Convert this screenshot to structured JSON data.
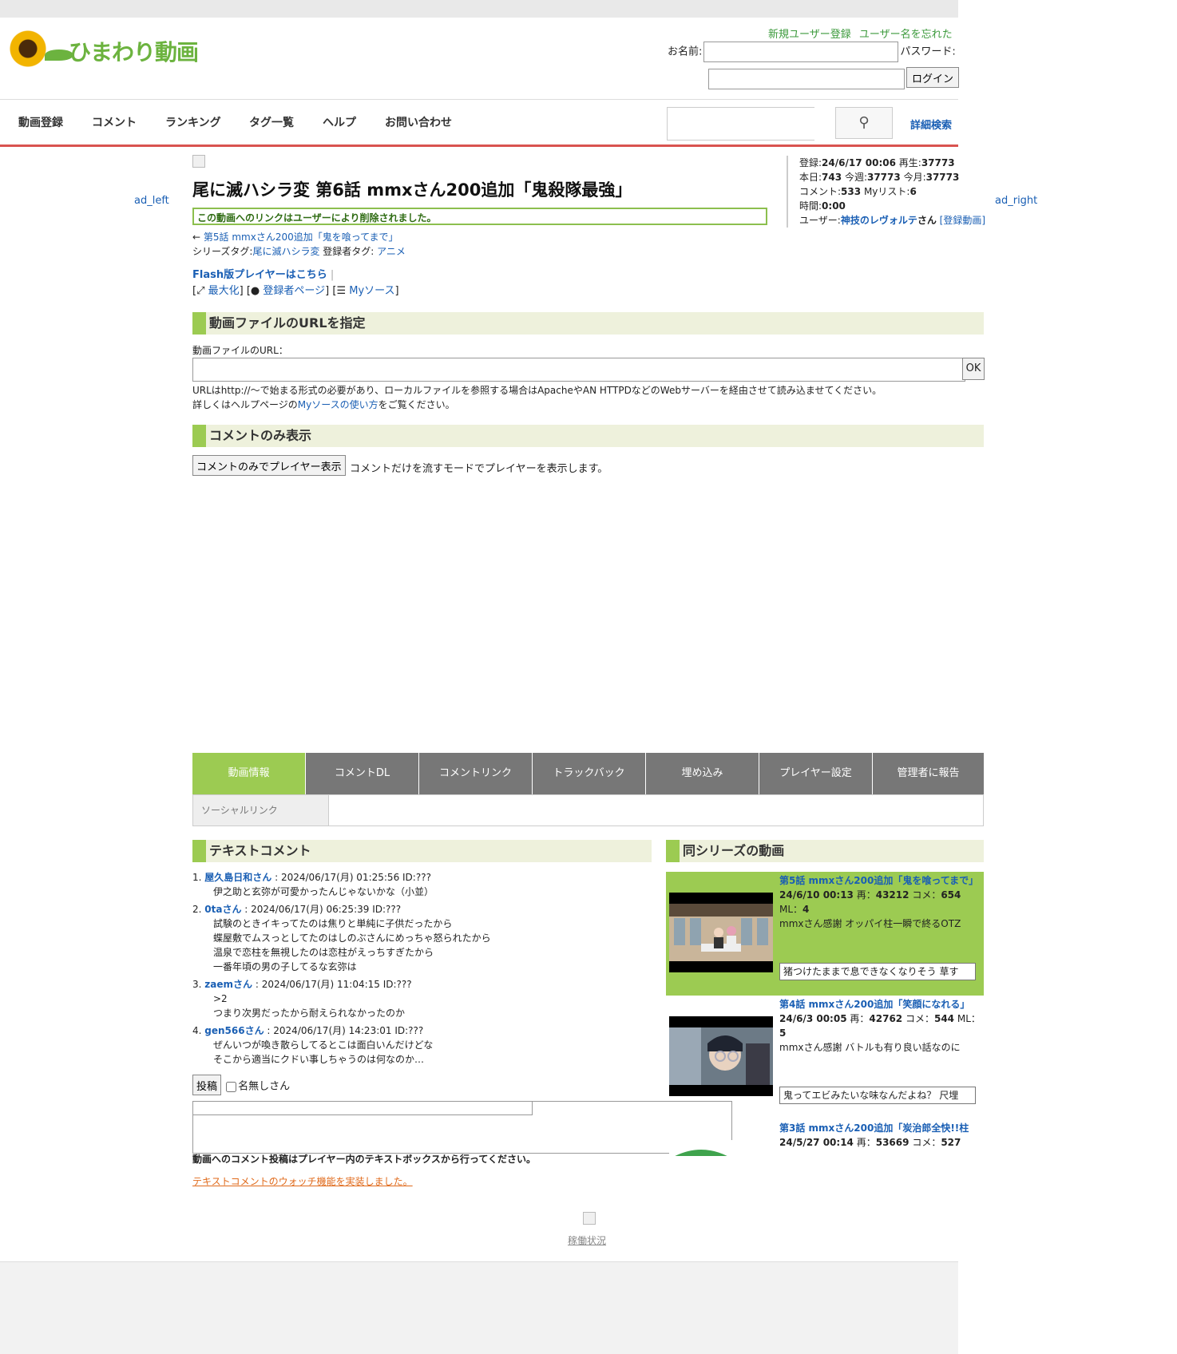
{
  "logo": {
    "text": "ひまわり動画"
  },
  "header": {
    "register_link": "新規ユーザー登録",
    "forgot_link": "ユーザー名を忘れたら",
    "name_label": "お名前:",
    "password_label": "パスワード:",
    "login_button": "ログイン"
  },
  "nav": {
    "items": [
      "動画登録",
      "コメント",
      "ランキング",
      "タグ一覧",
      "ヘルプ",
      "お問い合わせ"
    ],
    "advanced_search": "詳細検索"
  },
  "ads": {
    "left": "ad_left",
    "right": "ad_right"
  },
  "video": {
    "title": "尾に滅ハシラ変 第6話 mmxさん200追加「鬼殺隊最強」",
    "deleted_notice": "この動画へのリンクはユーザーにより削除されました。",
    "prev_arrow": "←",
    "prev_link": "第5話 mmxさん200追加「鬼を喰ってまで」",
    "series_tag_label": "シリーズタグ:",
    "series_tag": "尾に滅ハシラ変",
    "registrant_tag_label": "登録者タグ:",
    "registrant_tag": "アニメ",
    "flash_link": "Flash版プレイヤーはこちら",
    "maximize": "最大化",
    "registrant_page": "登録者ページ",
    "my_source": "Myソース"
  },
  "info": {
    "registered_label": "登録:",
    "registered": "24/6/17 00:06",
    "plays_label": "再生:",
    "plays": "37773",
    "today_label": "本日:",
    "today": "743",
    "week_label": "今週:",
    "week": "37773",
    "month_label": "今月:",
    "month": "37773",
    "comments_label": "コメント:",
    "comments": "533",
    "mylist_label": "Myリスト:",
    "mylist": "6",
    "time_label": "時間:",
    "time": "0:00",
    "user_label": "ユーザー:",
    "user": "神技のレヴォルテ",
    "user_suffix": "さん",
    "registered_videos": "[登録動画]"
  },
  "url_section": {
    "heading": "動画ファイルのURLを指定",
    "label": "動画ファイルのURL：",
    "ok": "OK",
    "note1": "URLはhttp://〜で始まる形式の必要があり、ローカルファイルを参照する場合はApacheやAN HTTPDなどのWebサーバーを経由させて読み込ませてください。",
    "note2_pre": "詳しくはヘルプページの",
    "note2_link": "Myソースの使い方",
    "note2_post": "をご覧ください。"
  },
  "comment_only": {
    "heading": "コメントのみ表示",
    "button": "コメントのみでプレイヤー表示",
    "note": "コメントだけを流すモードでプレイヤーを表示します。"
  },
  "tabs": [
    "動画情報",
    "コメントDL",
    "コメントリンク",
    "トラックバック",
    "埋め込み",
    "プレイヤー設定",
    "管理者に報告"
  ],
  "subtab": "ソーシャルリンク",
  "text_comments": {
    "heading": "テキストコメント",
    "items": [
      {
        "num": "1.",
        "who": "屋久島日和さん",
        "meta": " : 2024/06/17(月) 01:25:56 ID:???",
        "lines": [
          "伊之助と玄弥が可愛かったんじゃないかな（小並）"
        ]
      },
      {
        "num": "2.",
        "who": "0taさん",
        "meta": " : 2024/06/17(月) 06:25:39 ID:???",
        "lines": [
          "試験のときイキってたのは焦りと単純に子供だったから",
          "蝶屋敷でムスっとしてたのはしのぶさんにめっちゃ怒られたから",
          "温泉で恋柱を無視したのは恋柱がえっちすぎたから",
          "一番年頃の男の子してるな玄弥は"
        ]
      },
      {
        "num": "3.",
        "who": "zaemさん",
        "meta": " : 2024/06/17(月) 11:04:15 ID:???",
        "lines": [
          ">2",
          "つまり次男だったから耐えられなかったのか"
        ]
      },
      {
        "num": "4.",
        "who": "gen566さん",
        "meta": " : 2024/06/17(月) 14:23:01 ID:???",
        "lines": [
          "ぜんいつが喚き散らしてるとこは面白いんだけどな",
          "そこから適当にクドい事しちゃうのは何なのか…"
        ]
      }
    ],
    "post_button": "投稿",
    "anon_label": "名無しさん",
    "post_note": "動画へのコメント投稿はプレイヤー内のテキストボックスから行ってください。",
    "watch_link": "テキストコメントのウォッチ機能を実装しました。"
  },
  "series_videos": {
    "heading": "同シリーズの動画",
    "items": [
      {
        "title": "第5話 mmxさん200追加「鬼を喰ってまで」",
        "date": "24/6/10 00:13",
        "plays_label": "再：",
        "plays": "43212",
        "comments_label": "コメ：",
        "comments": "654",
        "ml_label": "ML：",
        "ml": "4",
        "desc": "mmxさん感謝 オッパイ柱一瞬で終るOTZ",
        "last_comment": "猪つけたままで息できなくなりそう 草す"
      },
      {
        "title": "第4話 mmxさん200追加「笑顔になれる」",
        "date": "24/6/3 00:05",
        "plays_label": "再：",
        "plays": "42762",
        "comments_label": "コメ：",
        "comments": "544",
        "ml_label": "ML：",
        "ml": "5",
        "desc": "mmxさん感謝 バトルも有り良い話なのに",
        "last_comment": "鬼ってエビみたいな味なんだよね？ 尺埋"
      },
      {
        "title": "第3話 mmxさん200追加「炭治郎全快!!柱",
        "date": "24/5/27 00:14",
        "plays_label": "再：",
        "plays": "53669",
        "comments_label": "コメ：",
        "comments": "527",
        "ml_label": "ML：",
        "ml": "",
        "desc": "",
        "last_comment": ""
      }
    ]
  },
  "footer": {
    "status_link": "稼働状況"
  },
  "colors": {
    "accent_green": "#9ccb52",
    "nav_border": "#d9534f",
    "tab_gray": "#777777",
    "link_blue": "#1a5fb4"
  }
}
